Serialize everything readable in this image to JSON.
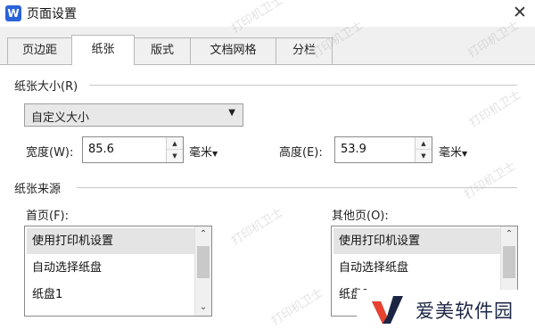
{
  "window": {
    "app_icon_letter": "W",
    "title": "页面设置",
    "close_glyph": "✕"
  },
  "tabs": [
    {
      "label": "页边距",
      "active": false
    },
    {
      "label": "纸张",
      "active": true
    },
    {
      "label": "版式",
      "active": false
    },
    {
      "label": "文档网格",
      "active": false
    },
    {
      "label": "分栏",
      "active": false
    }
  ],
  "paper_size": {
    "section_title": "纸张大小(R)",
    "selected": "自定义大小",
    "width_label": "宽度(W):",
    "width_value": "85.6",
    "height_label": "高度(E):",
    "height_value": "53.9",
    "unit": "毫米"
  },
  "paper_source": {
    "section_title": "纸张来源",
    "first_page_label": "首页(F):",
    "other_pages_label": "其他页(O):",
    "first_page_items": [
      "使用打印机设置",
      "自动选择纸盘",
      "纸盘1"
    ],
    "other_pages_items": [
      "使用打印机设置",
      "自动选择纸盘",
      "纸盘1"
    ]
  },
  "watermark_text": "打印机卫士",
  "brand": {
    "name": "爱美软件园",
    "colors": {
      "red": "#e8432f",
      "navy": "#1c2544"
    }
  },
  "icons": {
    "close": "close-icon",
    "dropdown": "chevron-down-icon",
    "spin_up": "spin-up-icon",
    "spin_down": "spin-down-icon",
    "scroll_up": "scroll-up-icon",
    "scroll_down": "scroll-down-icon"
  }
}
